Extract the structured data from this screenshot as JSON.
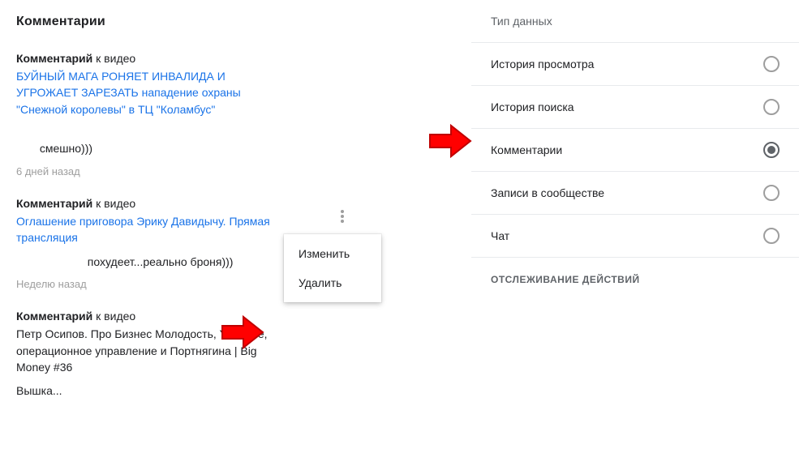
{
  "left": {
    "title": "Комментарии",
    "comment_prefix": "Комментарий",
    "to_video": " к видео",
    "comments": [
      {
        "video_title": "БУЙНЫЙ МАГА РОНЯЕТ ИНВАЛИДА И УГРОЖАЕТ ЗАРЕЗАТЬ нападение охраны \"Снежной королевы\" в ТЦ \"Коламбус\"",
        "body_tail": "смешно)))",
        "time": "6 дней назад"
      },
      {
        "video_title": "Оглашение приговора Эрику Давидычу. Прямая трансляция",
        "body_tail": "похудеет...реально броня)))",
        "time": "Неделю назад"
      },
      {
        "video_title": "Петр Осипов. Про Бизнес Молодость, YouTube, операционное управление и Портнягина | Big Money #36",
        "body_tail": "Вышка...",
        "time": ""
      }
    ],
    "menu": {
      "edit": "Изменить",
      "delete": "Удалить"
    }
  },
  "right": {
    "section": "Тип данных",
    "options": [
      {
        "label": "История просмотра",
        "selected": false
      },
      {
        "label": "История поиска",
        "selected": false
      },
      {
        "label": "Комментарии",
        "selected": true
      },
      {
        "label": "Записи в сообществе",
        "selected": false
      },
      {
        "label": "Чат",
        "selected": false
      }
    ],
    "tracking": "ОТСЛЕЖИВАНИЕ ДЕЙСТВИЙ"
  }
}
